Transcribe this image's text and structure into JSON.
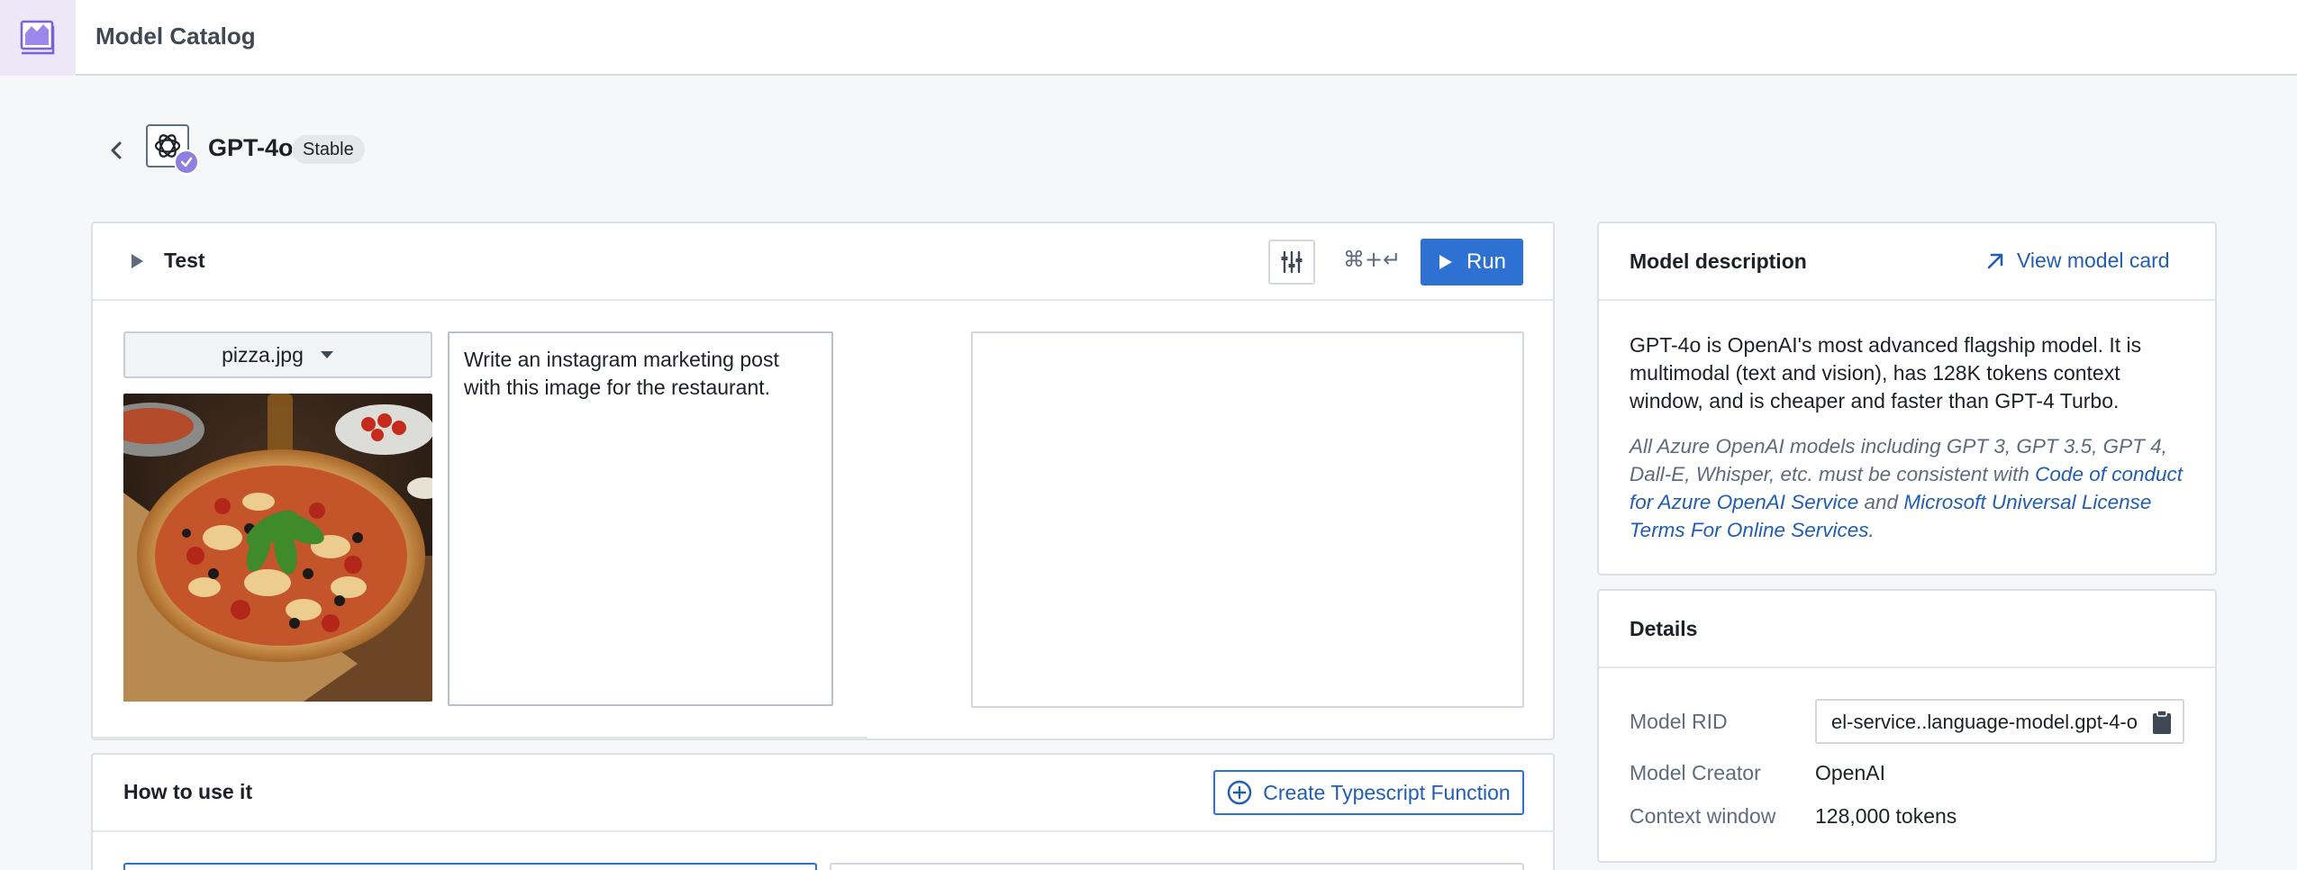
{
  "app": {
    "title": "Model Catalog",
    "icon": "model-catalog-icon"
  },
  "model": {
    "name": "GPT-4o",
    "status": "Stable",
    "logo": "openai-logo-icon",
    "badge": "verified-check-icon"
  },
  "test": {
    "title": "Test",
    "shortcut": "⌘+↵",
    "run_label": "Run",
    "file": {
      "selected": "pizza.jpg"
    },
    "prompt": "Write an instagram marketing post with this image for the restaurant.",
    "output": ""
  },
  "how_to_use": {
    "title": "How to use it",
    "create_button": "Create Typescript Function"
  },
  "description": {
    "title": "Model description",
    "view_card_label": "View model card",
    "body": "GPT-4o is OpenAI's most advanced flagship model. It is multimodal (text and vision), has 128K tokens context window, and is cheaper and faster than GPT-4 Turbo.",
    "legal_prefix": "All Azure OpenAI models including GPT 3, GPT 3.5, GPT 4, Dall-E, Whisper, etc. must be consistent with ",
    "legal_link1": "Code of conduct for Azure OpenAI Service",
    "legal_mid": " and ",
    "legal_link2": "Microsoft Universal License Terms For Online Services",
    "legal_suffix": "."
  },
  "details": {
    "title": "Details",
    "rid_label": "Model RID",
    "rid_value": "el-service..language-model.gpt-4-o",
    "creator_label": "Model Creator",
    "creator_value": "OpenAI",
    "context_label": "Context window",
    "context_value": "128,000 tokens"
  },
  "colors": {
    "primary": "#2d72d2",
    "link": "#215db0",
    "accent_purple": "#8f7fe0"
  }
}
